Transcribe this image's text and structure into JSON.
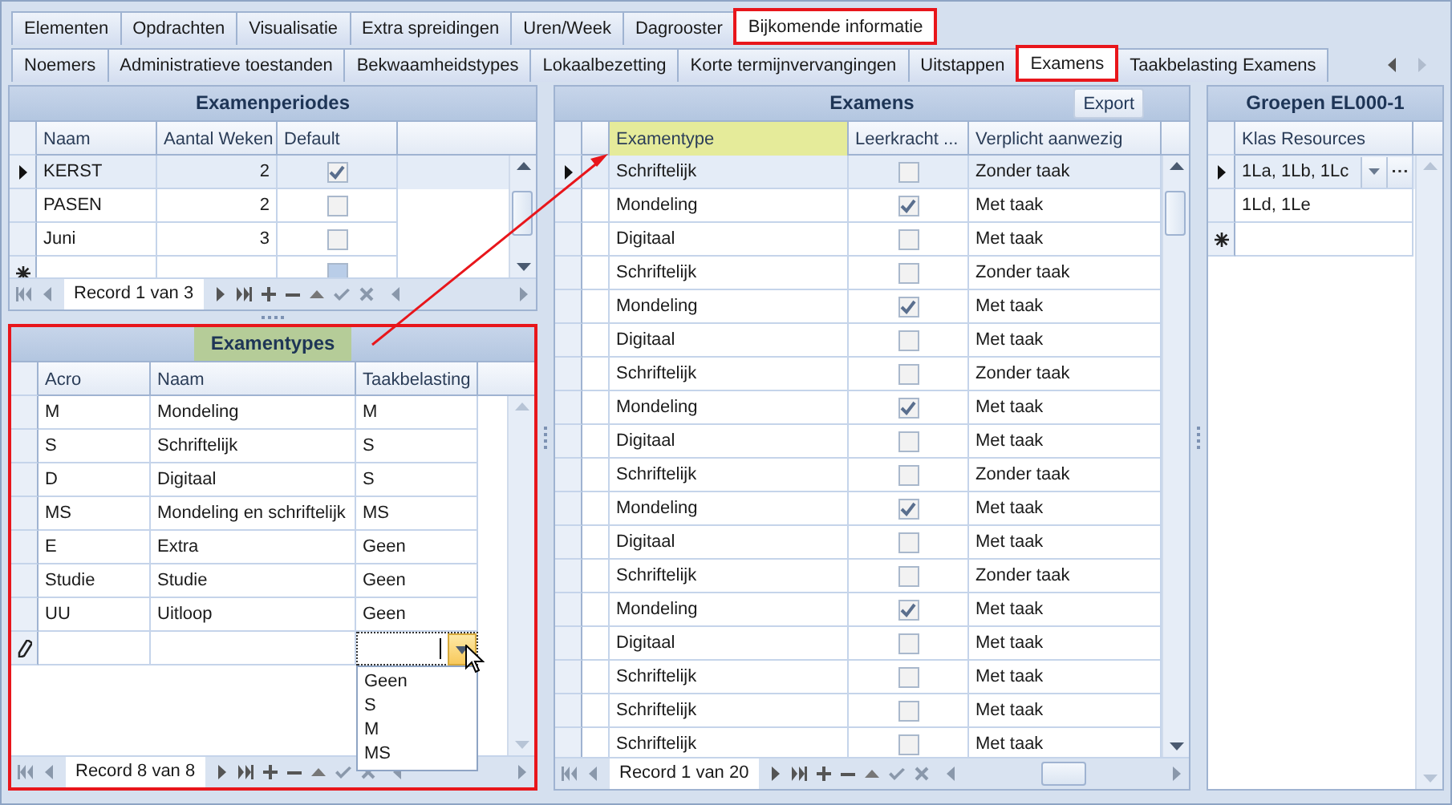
{
  "tabs_main": [
    {
      "label": "Elementen",
      "selected": false,
      "annotated": false
    },
    {
      "label": "Opdrachten",
      "selected": false,
      "annotated": false
    },
    {
      "label": "Visualisatie",
      "selected": false,
      "annotated": false
    },
    {
      "label": "Extra spreidingen",
      "selected": false,
      "annotated": false
    },
    {
      "label": "Uren/Week",
      "selected": false,
      "annotated": false
    },
    {
      "label": "Dagrooster",
      "selected": false,
      "annotated": false
    },
    {
      "label": "Bijkomende informatie",
      "selected": true,
      "annotated": true
    }
  ],
  "tabs_sub": [
    {
      "label": "Noemers",
      "selected": false,
      "annotated": false
    },
    {
      "label": "Administratieve toestanden",
      "selected": false,
      "annotated": false
    },
    {
      "label": "Bekwaamheidstypes",
      "selected": false,
      "annotated": false
    },
    {
      "label": "Lokaalbezetting",
      "selected": false,
      "annotated": false
    },
    {
      "label": "Korte termijnvervangingen",
      "selected": false,
      "annotated": false
    },
    {
      "label": "Uitstappen",
      "selected": false,
      "annotated": false
    },
    {
      "label": "Examens",
      "selected": true,
      "annotated": true
    },
    {
      "label": "Taakbelasting Examens",
      "selected": false,
      "annotated": false
    }
  ],
  "examenperiodes": {
    "title": "Examenperiodes",
    "columns": [
      "Naam",
      "Aantal Weken",
      "Default"
    ],
    "rows": [
      {
        "kind": "current",
        "naam": "KERST",
        "weken": "2",
        "default": true
      },
      {
        "kind": "plain",
        "naam": "PASEN",
        "weken": "2",
        "default": false
      },
      {
        "kind": "plain",
        "naam": "Juni",
        "weken": "3",
        "default": false
      },
      {
        "kind": "new",
        "default": false
      }
    ],
    "navigator": "Record 1 van 3"
  },
  "examentypes": {
    "title": "Examentypes",
    "title_highlighted": true,
    "annotated": true,
    "columns": [
      "Acro",
      "Naam",
      "Taakbelasting"
    ],
    "rows": [
      {
        "acro": "M",
        "naam": "Mondeling",
        "taak": "M"
      },
      {
        "acro": "S",
        "naam": "Schriftelijk",
        "taak": "S"
      },
      {
        "acro": "D",
        "naam": "Digitaal",
        "taak": "S"
      },
      {
        "acro": "MS",
        "naam": "Mondeling en schriftelijk",
        "taak": "MS"
      },
      {
        "acro": "E",
        "naam": "Extra",
        "taak": "Geen"
      },
      {
        "acro": "Studie",
        "naam": "Studie",
        "taak": "Geen"
      },
      {
        "acro": "UU",
        "naam": "Uitloop",
        "taak": "Geen"
      }
    ],
    "dropdown_options": [
      "Geen",
      "S",
      "M",
      "MS"
    ],
    "navigator": "Record 8 van 8"
  },
  "examens": {
    "title": "Examens",
    "export_button": "Export",
    "columns": [
      {
        "label": "Examentype",
        "highlighted": true
      },
      {
        "label": "Leerkracht ...",
        "highlighted": false
      },
      {
        "label": "Verplicht aanwezig",
        "highlighted": false
      }
    ],
    "rows": [
      {
        "current": true,
        "type": "Schriftelijk",
        "leerkracht": false,
        "verplicht": "Zonder taak"
      },
      {
        "current": false,
        "type": "Mondeling",
        "leerkracht": true,
        "verplicht": "Met taak"
      },
      {
        "current": false,
        "type": "Digitaal",
        "leerkracht": false,
        "verplicht": "Met taak"
      },
      {
        "current": false,
        "type": "Schriftelijk",
        "leerkracht": false,
        "verplicht": "Zonder taak"
      },
      {
        "current": false,
        "type": "Mondeling",
        "leerkracht": true,
        "verplicht": "Met taak"
      },
      {
        "current": false,
        "type": "Digitaal",
        "leerkracht": false,
        "verplicht": "Met taak"
      },
      {
        "current": false,
        "type": "Schriftelijk",
        "leerkracht": false,
        "verplicht": "Zonder taak"
      },
      {
        "current": false,
        "type": "Mondeling",
        "leerkracht": true,
        "verplicht": "Met taak"
      },
      {
        "current": false,
        "type": "Digitaal",
        "leerkracht": false,
        "verplicht": "Met taak"
      },
      {
        "current": false,
        "type": "Schriftelijk",
        "leerkracht": false,
        "verplicht": "Zonder taak"
      },
      {
        "current": false,
        "type": "Mondeling",
        "leerkracht": true,
        "verplicht": "Met taak"
      },
      {
        "current": false,
        "type": "Digitaal",
        "leerkracht": false,
        "verplicht": "Met taak"
      },
      {
        "current": false,
        "type": "Schriftelijk",
        "leerkracht": false,
        "verplicht": "Zonder taak"
      },
      {
        "current": false,
        "type": "Mondeling",
        "leerkracht": true,
        "verplicht": "Met taak"
      },
      {
        "current": false,
        "type": "Digitaal",
        "leerkracht": false,
        "verplicht": "Met taak"
      },
      {
        "current": false,
        "type": "Schriftelijk",
        "leerkracht": false,
        "verplicht": "Met taak"
      },
      {
        "current": false,
        "type": "Schriftelijk",
        "leerkracht": false,
        "verplicht": "Met taak"
      },
      {
        "current": false,
        "type": "Schriftelijk",
        "leerkracht": false,
        "verplicht": "Met taak"
      }
    ],
    "navigator": "Record 1 van 20"
  },
  "groepen": {
    "title": "Groepen EL000-1",
    "column": "Klas Resources",
    "rows": [
      {
        "kind": "current",
        "klassen": "1La, 1Lb, 1Lc"
      },
      {
        "kind": "plain",
        "klassen": "1Ld, 1Le"
      },
      {
        "kind": "new"
      }
    ]
  }
}
